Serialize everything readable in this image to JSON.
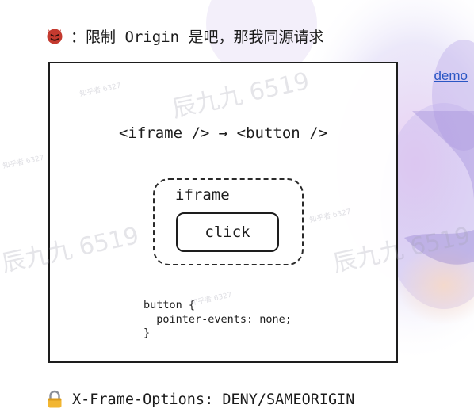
{
  "header": {
    "text": "：限制 Origin 是吧，那我同源请求",
    "emoji_icon": "devil-face-icon"
  },
  "demo_link": {
    "label": "demo",
    "color": "#2a56c4"
  },
  "diagram": {
    "heading": "<iframe /> → <button />",
    "iframe_label": "iframe",
    "button_label": "click",
    "code_lines": [
      "button {",
      "  pointer-events: none;",
      "}"
    ]
  },
  "footer": {
    "text": "X-Frame-Options: DENY/SAMEORIGIN",
    "emoji_icon": "locked-padlock-icon"
  },
  "watermarks": {
    "big_1": "辰九九 6519",
    "big_2": "辰九九 6519",
    "big_3": "辰九九 6519",
    "small_1": "知乎者 6327",
    "small_2": "知乎者 6327",
    "small_3": "知乎者 6327",
    "small_4": "知乎者 6327"
  },
  "colors": {
    "ink": "#1d1d1d",
    "link": "#2a56c4",
    "background": "#ffffff"
  }
}
